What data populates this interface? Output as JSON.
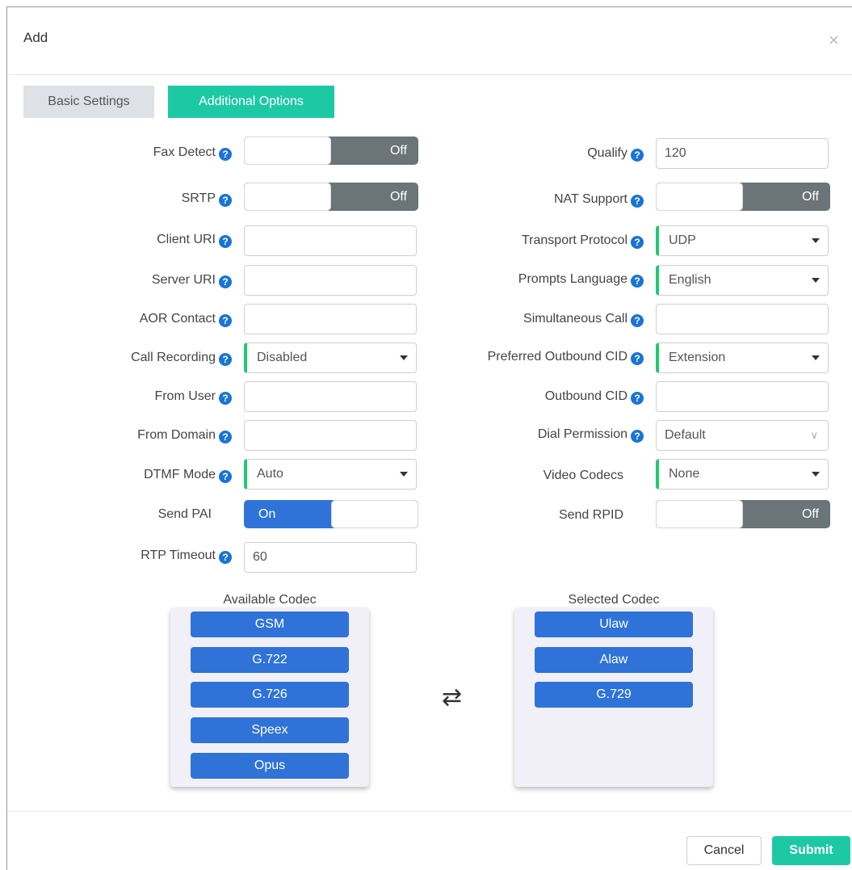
{
  "dialog": {
    "title": "Add",
    "close_glyph": "×",
    "tabs": [
      {
        "label": "Basic Settings",
        "active": false
      },
      {
        "label": "Additional Options",
        "active": true
      }
    ]
  },
  "help_glyph": "?",
  "left": {
    "fax_detect": {
      "label": "Fax Detect",
      "state": "Off"
    },
    "srtp": {
      "label": "SRTP",
      "state": "Off"
    },
    "client_uri": {
      "label": "Client URI",
      "value": ""
    },
    "server_uri": {
      "label": "Server URI",
      "value": ""
    },
    "aor_contact": {
      "label": "AOR Contact",
      "value": ""
    },
    "call_recording": {
      "label": "Call Recording",
      "value": "Disabled"
    },
    "from_user": {
      "label": "From User",
      "value": ""
    },
    "from_domain": {
      "label": "From Domain",
      "value": ""
    },
    "dtmf_mode": {
      "label": "DTMF Mode",
      "value": "Auto"
    },
    "send_pai": {
      "label": "Send PAI",
      "state": "On"
    },
    "rtp_timeout": {
      "label": "RTP Timeout",
      "value": "60"
    }
  },
  "right": {
    "qualify": {
      "label": "Qualify",
      "value": "120"
    },
    "nat_support": {
      "label": "NAT Support",
      "state": "Off"
    },
    "transport_protocol": {
      "label": "Transport Protocol",
      "value": "UDP"
    },
    "prompts_language": {
      "label": "Prompts Language",
      "value": "English"
    },
    "simultaneous_call": {
      "label": "Simultaneous Call",
      "value": ""
    },
    "preferred_outbound_cid": {
      "label": "Preferred Outbound CID",
      "value": "Extension"
    },
    "outbound_cid": {
      "label": "Outbound CID",
      "value": ""
    },
    "dial_permission": {
      "label": "Dial Permission",
      "value": "Default"
    },
    "video_codecs": {
      "label": "Video Codecs",
      "value": "None"
    },
    "send_rpid": {
      "label": "Send RPID",
      "state": "Off"
    }
  },
  "codecs": {
    "available_title": "Available Codec",
    "selected_title": "Selected Codec",
    "available": [
      "GSM",
      "G.722",
      "G.726",
      "Speex",
      "Opus"
    ],
    "selected": [
      "Ulaw",
      "Alaw",
      "G.729"
    ],
    "swap_glyph": "⇄"
  },
  "footer": {
    "cancel": "Cancel",
    "submit": "Submit"
  },
  "colors": {
    "accent": "#1dc9a5",
    "primary_blue": "#2f73d8",
    "toggle_off": "#6a7479",
    "select_marker": "#1ecb70",
    "help_icon": "#1a74d6"
  }
}
